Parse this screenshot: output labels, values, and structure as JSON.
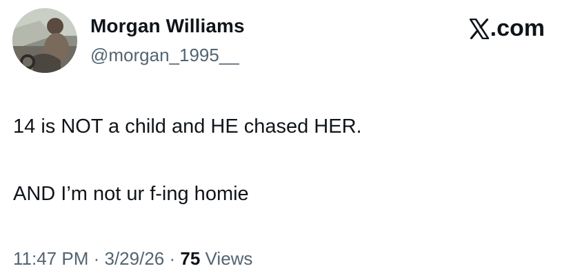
{
  "author": {
    "display_name": "Morgan Williams",
    "handle": "@morgan_1995__",
    "avatar": "profile-photo"
  },
  "brand": {
    "icon": "x-logo-icon",
    "suffix": ".com"
  },
  "tweet": {
    "lines": [
      "14 is NOT a child and HE chased HER.",
      "AND I’m not ur f-ing homie"
    ]
  },
  "meta": {
    "time": "11:47 PM",
    "separator": "·",
    "date": "3/29/26",
    "views_count": "75",
    "views_label": "Views"
  },
  "colors": {
    "text": "#0f1419",
    "secondary": "#536471"
  }
}
